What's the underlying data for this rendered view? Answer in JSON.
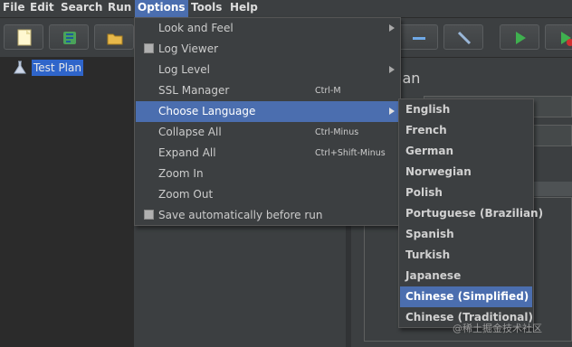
{
  "menubar": {
    "items": [
      {
        "label": "File"
      },
      {
        "label": "Edit"
      },
      {
        "label": "Search"
      },
      {
        "label": "Run"
      },
      {
        "label": "Options"
      },
      {
        "label": "Tools"
      },
      {
        "label": "Help"
      }
    ],
    "active": "Options"
  },
  "tree": {
    "root_label": "Test Plan"
  },
  "panel": {
    "title_partial": "lan"
  },
  "options_menu": {
    "items": [
      {
        "label": "Look and Feel",
        "accelerator": "",
        "submenu": true
      },
      {
        "label": "Log Viewer",
        "accelerator": "",
        "checkbox": true
      },
      {
        "label": "Log Level",
        "accelerator": "",
        "submenu": true
      },
      {
        "label": "SSL Manager",
        "accelerator": "Ctrl-M"
      },
      {
        "label": "Choose Language",
        "accelerator": "",
        "submenu": true,
        "selected": true
      },
      {
        "label": "Collapse All",
        "accelerator": "Ctrl-Minus"
      },
      {
        "label": "Expand All",
        "accelerator": "Ctrl+Shift-Minus"
      },
      {
        "label": "Zoom In",
        "accelerator": ""
      },
      {
        "label": "Zoom Out",
        "accelerator": ""
      },
      {
        "label": "Save automatically before run",
        "accelerator": "",
        "checkbox": true
      }
    ]
  },
  "language_submenu": {
    "items": [
      {
        "label": "English"
      },
      {
        "label": "French"
      },
      {
        "label": "German"
      },
      {
        "label": "Norwegian"
      },
      {
        "label": "Polish"
      },
      {
        "label": "Portuguese (Brazilian)"
      },
      {
        "label": "Spanish"
      },
      {
        "label": "Turkish"
      },
      {
        "label": "Japanese"
      },
      {
        "label": "Chinese (Simplified)",
        "selected": true
      },
      {
        "label": "Chinese (Traditional)"
      }
    ]
  },
  "watermark": "@稀土掘金技术社区",
  "colors": {
    "background": "#3c3f41",
    "selection": "#4b6eaf",
    "tree_background": "#2b2b2b",
    "tree_selection": "#2f65ca"
  }
}
